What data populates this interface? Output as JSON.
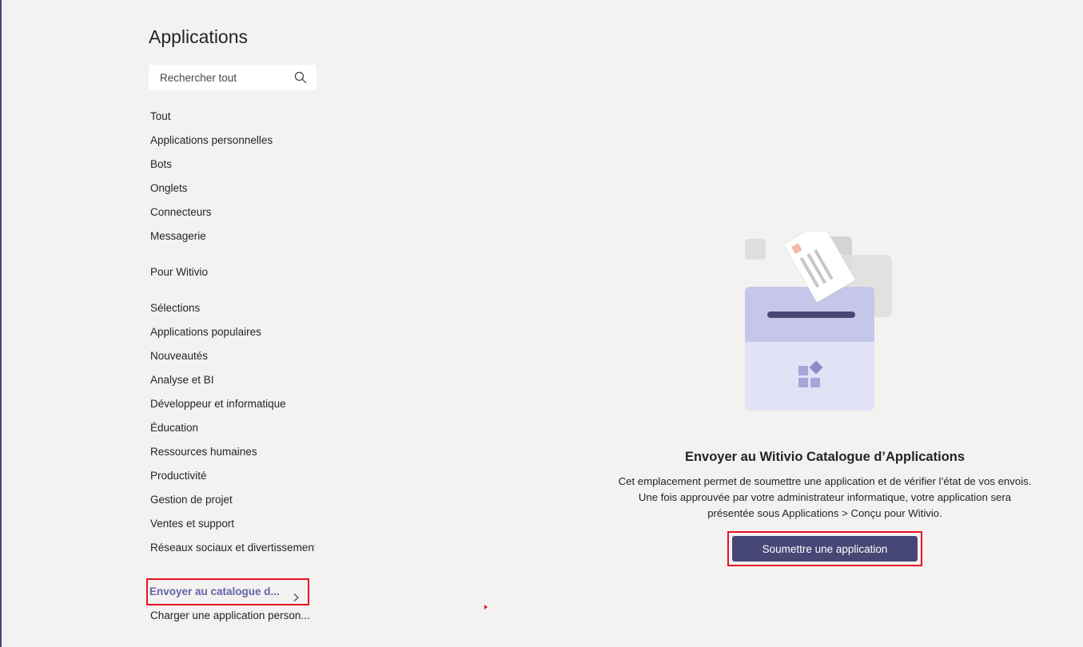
{
  "page": {
    "title": "Applications"
  },
  "search": {
    "placeholder": "Rechercher tout",
    "icon": "search-icon"
  },
  "nav": {
    "group1": [
      "Tout",
      "Applications personnelles",
      "Bots",
      "Onglets",
      "Connecteurs",
      "Messagerie"
    ],
    "group2": [
      "Pour Witivio"
    ],
    "group3": [
      "Sélections",
      "Applications populaires",
      "Nouveautés",
      "Analyse et BI",
      "Développeur et informatique",
      "Éducation",
      "Ressources humaines",
      "Productivité",
      "Gestion de projet",
      "Ventes et support",
      "Réseaux sociaux et divertissement"
    ],
    "submit": {
      "label": "Envoyer au catalogue d...",
      "icon": "chevron-right-icon"
    },
    "upload": {
      "label": "Charger une application person..."
    }
  },
  "main": {
    "heading": "Envoyer au Witivio Catalogue d’Applications",
    "description": "Cet emplacement permet de soumettre une application et de vérifier l’état de vos envois. Une fois approuvée par votre administrateur informatique, votre application sera présentée sous Applications > Conçu pour Witivio.",
    "button_label": "Soumettre une application"
  },
  "colors": {
    "background": "#f3f2f1",
    "accent": "#6264a7",
    "button": "#464775",
    "highlight": "#e81123"
  }
}
